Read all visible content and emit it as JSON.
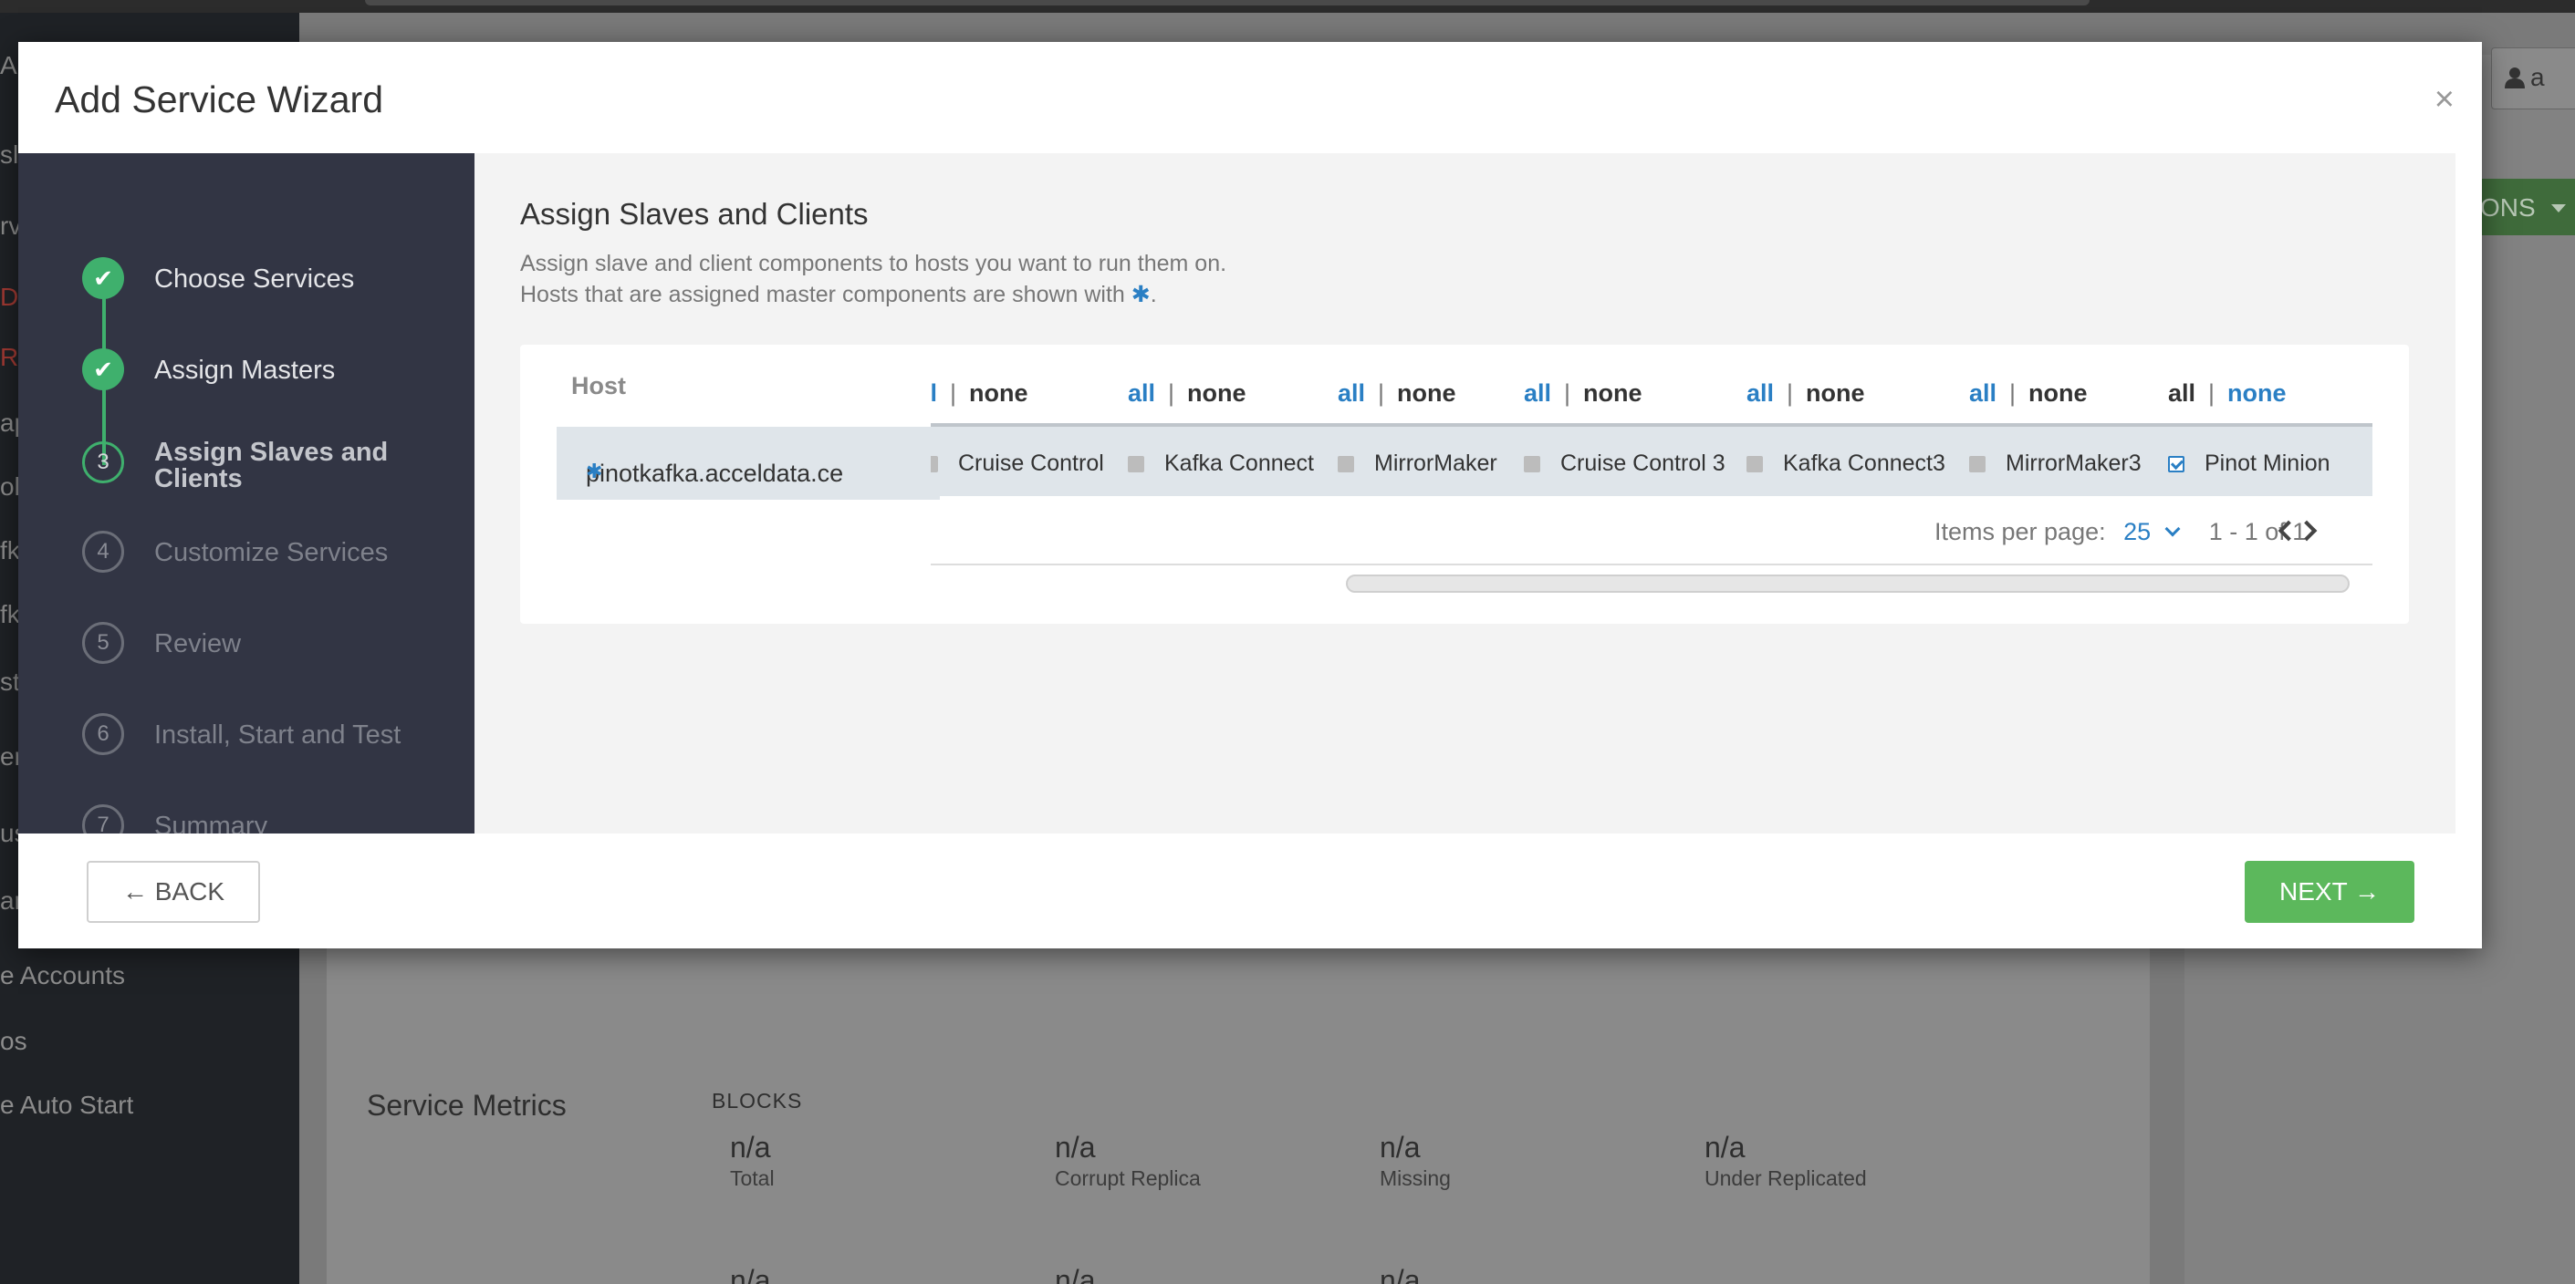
{
  "background": {
    "sidebar_items": [
      {
        "text": "A",
        "color": "normal"
      },
      {
        "text": "sl",
        "color": "normal"
      },
      {
        "text": "rv",
        "color": "normal"
      },
      {
        "text": "DF",
        "color": "red"
      },
      {
        "text": "R",
        "color": "red"
      },
      {
        "text": "ap",
        "color": "normal"
      },
      {
        "text": "ol",
        "color": "normal"
      },
      {
        "text": "fk",
        "color": "normal"
      },
      {
        "text": "fk",
        "color": "normal"
      },
      {
        "text": "st",
        "color": "normal"
      },
      {
        "text": "ert",
        "color": "normal"
      },
      {
        "text": "us",
        "color": "normal"
      },
      {
        "text": "ar",
        "color": "normal"
      },
      {
        "text": "e Accounts",
        "color": "normal"
      },
      {
        "text": "os",
        "color": "normal"
      },
      {
        "text": "e Auto Start",
        "color": "normal"
      }
    ],
    "user_button": "a",
    "actions_button": "ONS",
    "service_metrics_title": "Service Metrics",
    "blocks_label": "BLOCKS",
    "metrics": [
      {
        "value": "n/a",
        "label": "Total"
      },
      {
        "value": "n/a",
        "label": "Corrupt Replica"
      },
      {
        "value": "n/a",
        "label": "Missing"
      },
      {
        "value": "n/a",
        "label": "Under Replicated"
      }
    ],
    "metrics_row2": [
      "n/a",
      "n/a",
      "n/a"
    ]
  },
  "modal": {
    "title": "Add Service Wizard",
    "close_label": "×",
    "steps": [
      {
        "number": "1",
        "label": "Choose Services",
        "state": "done"
      },
      {
        "number": "2",
        "label": "Assign Masters",
        "state": "done"
      },
      {
        "number": "3",
        "label": "Assign Slaves and Clients",
        "state": "active"
      },
      {
        "number": "4",
        "label": "Customize Services",
        "state": "todo"
      },
      {
        "number": "5",
        "label": "Review",
        "state": "todo"
      },
      {
        "number": "6",
        "label": "Install, Start and Test",
        "state": "todo"
      },
      {
        "number": "7",
        "label": "Summary",
        "state": "todo"
      }
    ],
    "content": {
      "title": "Assign Slaves and Clients",
      "desc_line1": "Assign slave and client components to hosts you want to run them on.",
      "desc_line2_before": "Hosts that are assigned master components are shown with ",
      "desc_line2_star": "✱",
      "desc_line2_after": "."
    },
    "table": {
      "host_header": "Host",
      "host_value": "pinotkafka.acceldata.ce",
      "host_star": "✱",
      "all_label": "all",
      "none_label": "none",
      "first_all_partial": "ll",
      "columns": [
        {
          "label": "Cruise Control",
          "checked": false
        },
        {
          "label": "Kafka Connect",
          "checked": false
        },
        {
          "label": "MirrorMaker",
          "checked": false
        },
        {
          "label": "Cruise Control 3",
          "checked": false
        },
        {
          "label": "Kafka Connect3",
          "checked": false
        },
        {
          "label": "MirrorMaker3",
          "checked": false
        },
        {
          "label": "Pinot Minion",
          "checked": true
        }
      ],
      "items_per_page_label": "Items per page:",
      "items_per_page_value": "25",
      "range_text": "1 - 1 of 1"
    },
    "back_label": "← BACK",
    "next_label": "NEXT →"
  },
  "colors": {
    "accent_green": "#5cb85c",
    "step_green": "#3fb06d",
    "link_blue": "#2a7fc4",
    "nav_bg": "#323544"
  }
}
